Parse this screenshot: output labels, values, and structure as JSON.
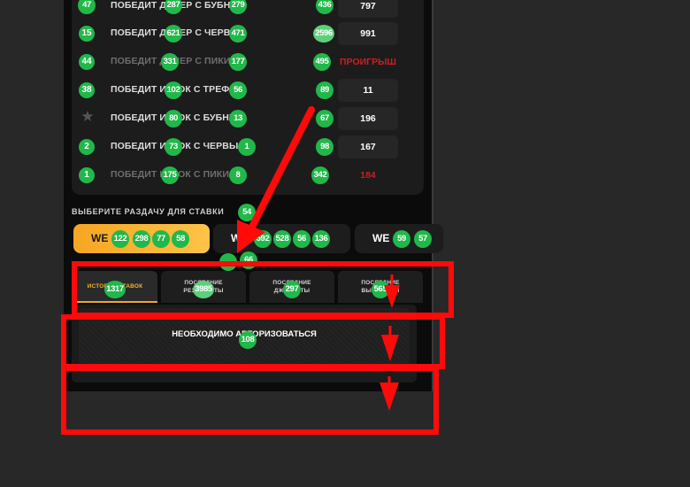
{
  "bets": [
    {
      "rank": "47",
      "label": "ПОБЕДИТ ДИЛЕР С БУБНЫ",
      "odds": "797",
      "dim": false,
      "lost": false,
      "star": false
    },
    {
      "rank": "15",
      "label": "ПОБЕДИТ ДИЛЕР С ЧЕРВЫ",
      "odds": "991",
      "dim": false,
      "lost": false,
      "star": false
    },
    {
      "rank": "44",
      "label": "ПОБЕДИТ ДИЛЕР С ПИКИ",
      "odds": "ПРОИГРЫШ",
      "dim": true,
      "lost": true,
      "star": false
    },
    {
      "rank": "38",
      "label": "ПОБЕДИТ ИГРОК С ТРЕФЫ",
      "odds": "11",
      "dim": false,
      "lost": false,
      "star": false
    },
    {
      "rank": "",
      "label": "ПОБЕДИТ ИГРОК С БУБНЫ",
      "odds": "196",
      "dim": false,
      "lost": false,
      "star": true
    },
    {
      "rank": "2",
      "label": "ПОБЕДИТ ИГРОК С ЧЕРВЫ",
      "odds": "167",
      "dim": false,
      "lost": false,
      "star": false
    },
    {
      "rank": "1",
      "label": "ПОБЕДИТ ИГРОК С ПИКИ",
      "odds": "184",
      "dim": true,
      "lost": true,
      "star": false
    }
  ],
  "overlay_badges": {
    "row0": [
      "287",
      "279",
      "436"
    ],
    "row1": [
      "621",
      "471",
      "2596"
    ],
    "row2": [
      "331",
      "177",
      "495"
    ],
    "row3": [
      "102",
      "56",
      "89"
    ],
    "row4": [
      "80",
      "13",
      "67"
    ],
    "row5": [
      "73",
      "1",
      "98"
    ],
    "row6": [
      "175",
      "8",
      "342"
    ],
    "title": "54",
    "deal1": [
      "122",
      "298",
      "77",
      "58"
    ],
    "deal2": [
      "592",
      "528",
      "56",
      "136"
    ],
    "deal3": [
      "59",
      "57"
    ],
    "below_deals": [
      "",
      "66"
    ],
    "tabs": [
      "1317",
      "3985",
      "297",
      "565"
    ],
    "auth": "108"
  },
  "section_title": "ВЫБЕРИТЕ РАЗДАЧУ ДЛЯ СТАВКИ",
  "deals": [
    "WE",
    "WE",
    "WE"
  ],
  "tabs": [
    {
      "line1": "ИСТОРИЯ СТАВОК",
      "line2": ""
    },
    {
      "line1": "ПОСЛЕДНИЕ",
      "line2": "РЕЗУЛЬТАТЫ"
    },
    {
      "line1": "ПОСЛЕДНИЕ",
      "line2": "ДЖЕКПОТЫ"
    },
    {
      "line1": "ПОСЛЕДНИЕ",
      "line2": "ВЫИГРЫШИ"
    }
  ],
  "auth_message": "НЕОБХОДИМО АВТОРИЗОВАТЬСЯ",
  "colors": {
    "accent": "#f5a623",
    "annotation": "#ff0a0a",
    "badge": "#21b84a",
    "lost": "#d01e1e"
  }
}
